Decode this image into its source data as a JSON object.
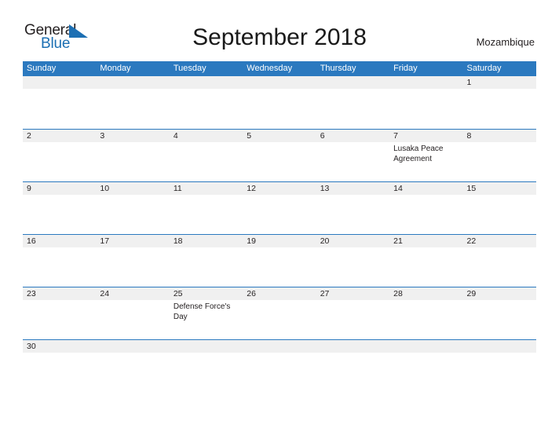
{
  "brand": {
    "name_part1": "General",
    "name_part2": "Blue",
    "flag_icon": "pennant-triangle-icon",
    "color_dark": "#231f20",
    "color_blue": "#1c6fb3"
  },
  "header": {
    "title": "September 2018",
    "region": "Mozambique"
  },
  "theme": {
    "header_band": "#2b79bf",
    "divider": "#2b79bf",
    "date_strip": "#f0f0f0",
    "text": "#231f20",
    "page_background": "#ffffff"
  },
  "calendar": {
    "month": "September",
    "year": "2018",
    "weekdays": [
      "Sunday",
      "Monday",
      "Tuesday",
      "Wednesday",
      "Thursday",
      "Friday",
      "Saturday"
    ],
    "weeks": [
      {
        "days": [
          {
            "date": "",
            "event": ""
          },
          {
            "date": "",
            "event": ""
          },
          {
            "date": "",
            "event": ""
          },
          {
            "date": "",
            "event": ""
          },
          {
            "date": "",
            "event": ""
          },
          {
            "date": "",
            "event": ""
          },
          {
            "date": "1",
            "event": ""
          }
        ]
      },
      {
        "days": [
          {
            "date": "2",
            "event": ""
          },
          {
            "date": "3",
            "event": ""
          },
          {
            "date": "4",
            "event": ""
          },
          {
            "date": "5",
            "event": ""
          },
          {
            "date": "6",
            "event": ""
          },
          {
            "date": "7",
            "event": "Lusaka Peace Agreement"
          },
          {
            "date": "8",
            "event": ""
          }
        ]
      },
      {
        "days": [
          {
            "date": "9",
            "event": ""
          },
          {
            "date": "10",
            "event": ""
          },
          {
            "date": "11",
            "event": ""
          },
          {
            "date": "12",
            "event": ""
          },
          {
            "date": "13",
            "event": ""
          },
          {
            "date": "14",
            "event": ""
          },
          {
            "date": "15",
            "event": ""
          }
        ]
      },
      {
        "days": [
          {
            "date": "16",
            "event": ""
          },
          {
            "date": "17",
            "event": ""
          },
          {
            "date": "18",
            "event": ""
          },
          {
            "date": "19",
            "event": ""
          },
          {
            "date": "20",
            "event": ""
          },
          {
            "date": "21",
            "event": ""
          },
          {
            "date": "22",
            "event": ""
          }
        ]
      },
      {
        "days": [
          {
            "date": "23",
            "event": ""
          },
          {
            "date": "24",
            "event": ""
          },
          {
            "date": "25",
            "event": "Defense Force's Day"
          },
          {
            "date": "26",
            "event": ""
          },
          {
            "date": "27",
            "event": ""
          },
          {
            "date": "28",
            "event": ""
          },
          {
            "date": "29",
            "event": ""
          }
        ]
      },
      {
        "days": [
          {
            "date": "30",
            "event": ""
          },
          {
            "date": "",
            "event": ""
          },
          {
            "date": "",
            "event": ""
          },
          {
            "date": "",
            "event": ""
          },
          {
            "date": "",
            "event": ""
          },
          {
            "date": "",
            "event": ""
          },
          {
            "date": "",
            "event": ""
          }
        ]
      }
    ]
  }
}
